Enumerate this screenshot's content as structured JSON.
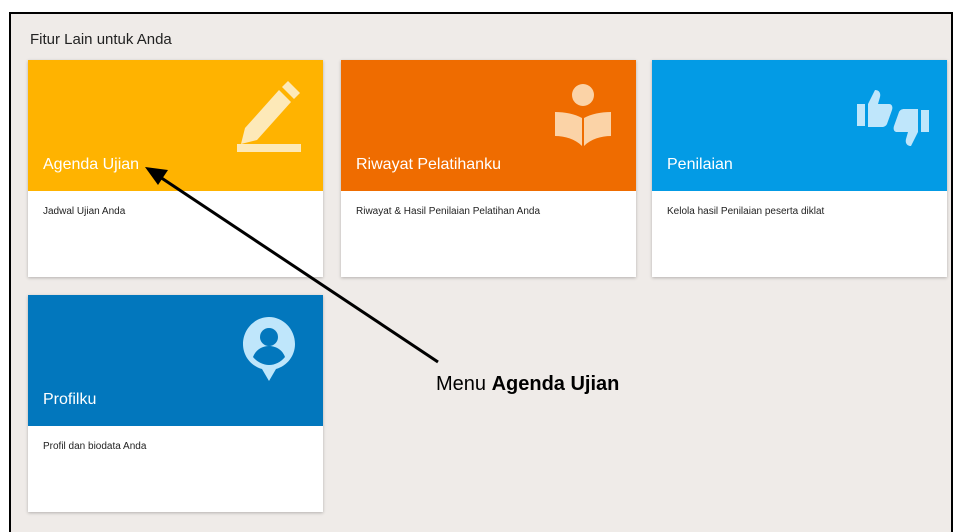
{
  "section": {
    "title": "Fitur Lain untuk Anda"
  },
  "cards": [
    {
      "title": "Agenda Ujian",
      "description": "Jadwal Ujian Anda",
      "color": "#ffb300",
      "icon": "pencil-icon"
    },
    {
      "title": "Riwayat Pelatihanku",
      "description": "Riwayat & Hasil Penilaian Pelatihan Anda",
      "color": "#ef6c00",
      "icon": "reader-book-icon"
    },
    {
      "title": "Penilaian",
      "description": "Kelola hasil Penilaian peserta diklat",
      "color": "#039be5",
      "icon": "thumbs-up-down-icon"
    },
    {
      "title": "Profilku",
      "description": "Profil dan biodata Anda",
      "color": "#0277bd",
      "icon": "user-pin-icon"
    }
  ],
  "annotation": {
    "prefix": "Menu ",
    "emphasis": "Agenda Ujian"
  },
  "colors": {
    "icon_tint": "#fff3c4",
    "background": "#efebe8"
  }
}
